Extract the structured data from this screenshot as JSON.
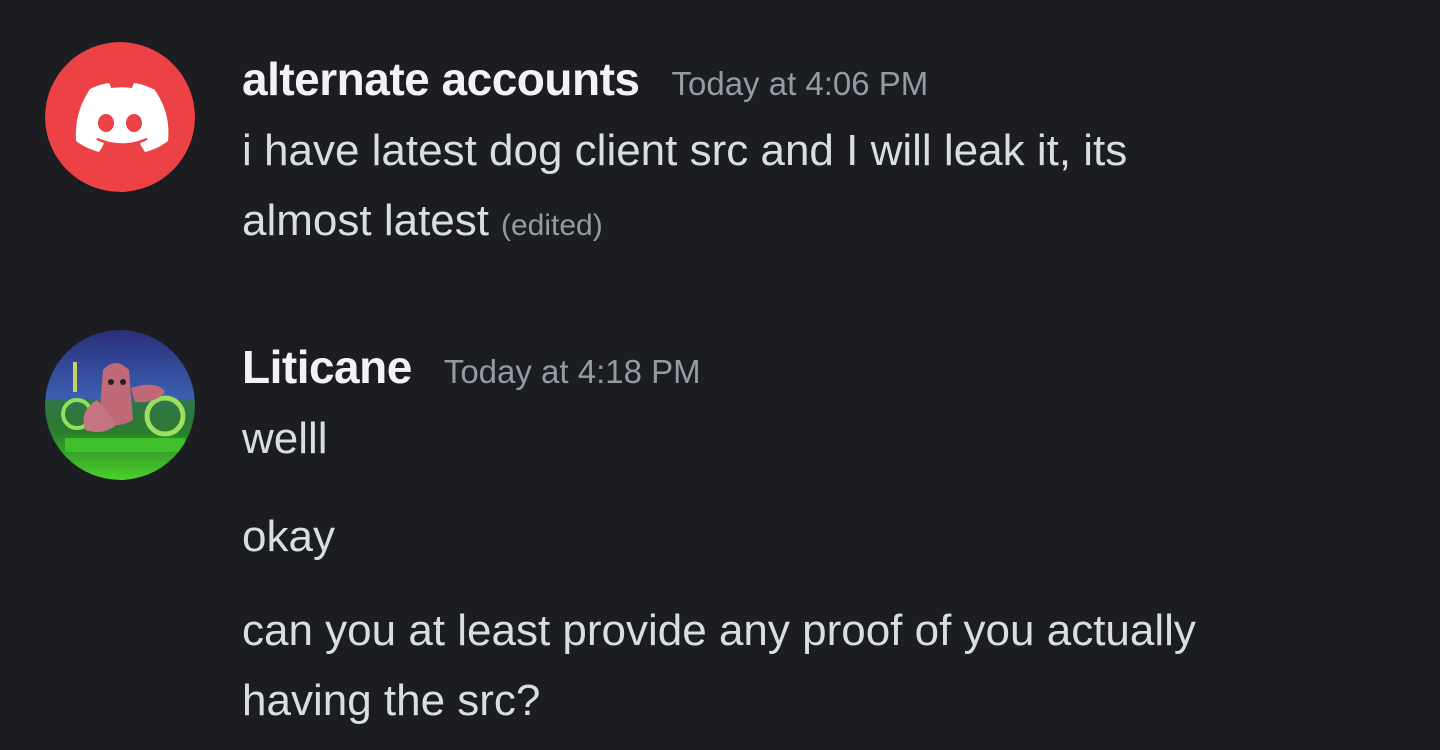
{
  "messages": [
    {
      "author": "alternate accounts",
      "timestamp": "Today at 4:06 PM",
      "avatar_icon": "discord-logo-icon",
      "avatar_color": "#ed4245",
      "blocks": [
        {
          "lines": [
            "i have latest dog client src and I will leak it, its",
            "almost latest"
          ],
          "edited_label": "(edited)"
        }
      ]
    },
    {
      "author": "Liticane",
      "timestamp": "Today at 4:18 PM",
      "avatar_icon": "cartoon-character-avatar-icon",
      "blocks": [
        {
          "lines": [
            "welll"
          ]
        },
        {
          "lines": [
            "okay"
          ]
        },
        {
          "lines": [
            "can you at least provide any proof of you actually",
            "having the src?"
          ]
        }
      ]
    }
  ],
  "colors": {
    "background": "#1c1d21",
    "username": "#f2f3f5",
    "text": "#dbdee1",
    "muted": "#949ba4"
  }
}
